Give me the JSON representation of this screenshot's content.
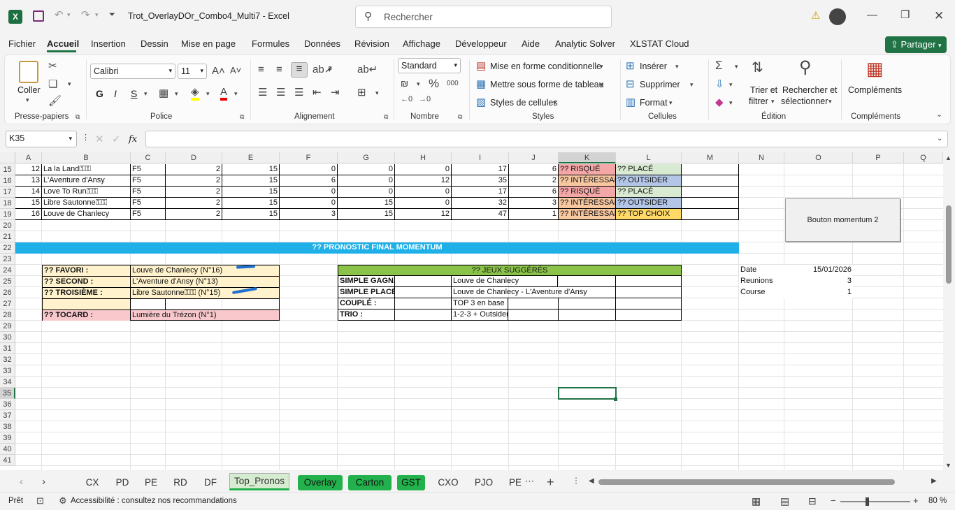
{
  "window": {
    "title": "Trot_OverlayDOr_Combo4_Multi7  -  Excel",
    "search_placeholder": "Rechercher"
  },
  "menu": {
    "items": [
      "Fichier",
      "Accueil",
      "Insertion",
      "Dessin",
      "Mise en page",
      "Formules",
      "Données",
      "Révision",
      "Affichage",
      "Développeur",
      "Aide",
      "Analytic Solver",
      "XLSTAT Cloud"
    ],
    "share": "Partager"
  },
  "ribbon": {
    "clipboard": {
      "paste": "Coller",
      "group": "Presse-papiers"
    },
    "font": {
      "name": "Calibri",
      "size": "11",
      "bold": "G",
      "italic": "I",
      "underline": "S",
      "group": "Police"
    },
    "alignment": {
      "group": "Alignement"
    },
    "number": {
      "format": "Standard",
      "group": "Nombre"
    },
    "styles": {
      "conditional": "Mise en forme conditionnelle",
      "table": "Mettre sous forme de tableau",
      "cell_styles": "Styles de cellules",
      "group": "Styles"
    },
    "cells": {
      "insert": "Insérer",
      "delete": "Supprimer",
      "format": "Format",
      "group": "Cellules"
    },
    "editing": {
      "sort1": "Trier et",
      "sort2": "filtrer",
      "find1": "Rechercher et",
      "find2": "sélectionner",
      "group": "Édition"
    },
    "addins": {
      "label": "Compléments",
      "group": "Compléments"
    }
  },
  "formula": {
    "namebox": "K35",
    "fx": "fx"
  },
  "columns": [
    "A",
    "B",
    "C",
    "D",
    "E",
    "F",
    "G",
    "H",
    "I",
    "J",
    "K",
    "L",
    "M",
    "N",
    "O",
    "P",
    "Q"
  ],
  "rows": [
    "15",
    "16",
    "17",
    "18",
    "19",
    "20",
    "21",
    "22",
    "23",
    "24",
    "25",
    "26",
    "27",
    "28",
    "29",
    "30",
    "31",
    "32",
    "33",
    "34",
    "35",
    "36",
    "37",
    "38",
    "39",
    "40",
    "41"
  ],
  "data_rows": [
    {
      "a": "12",
      "b": "La la Land⚿⚿",
      "c": "F5",
      "d": "2",
      "e": "15",
      "f": "0",
      "g": "0",
      "h": "0",
      "i": "17",
      "j": "6",
      "k": "?? RISQUÉ",
      "l": "?? PLACÉ"
    },
    {
      "a": "13",
      "b": "L'Aventure d'Ansy",
      "c": "F5",
      "d": "2",
      "e": "15",
      "f": "6",
      "g": "0",
      "h": "12",
      "i": "35",
      "j": "2",
      "k": "?? INTÉRESSAN",
      "l": "?? OUTSIDER"
    },
    {
      "a": "14",
      "b": "Love To Run⚿⚿",
      "c": "F5",
      "d": "2",
      "e": "15",
      "f": "0",
      "g": "0",
      "h": "0",
      "i": "17",
      "j": "6",
      "k": "?? RISQUÉ",
      "l": "?? PLACÉ"
    },
    {
      "a": "15",
      "b": "Libre Sautonne⚿⚿",
      "c": "F5",
      "d": "2",
      "e": "15",
      "f": "0",
      "g": "15",
      "h": "0",
      "i": "32",
      "j": "3",
      "k": "?? INTÉRESSAN",
      "l": "?? OUTSIDER"
    },
    {
      "a": "16",
      "b": "Louve de Chanlecy",
      "c": "F5",
      "d": "2",
      "e": "15",
      "f": "3",
      "g": "15",
      "h": "12",
      "i": "47",
      "j": "1",
      "k": "?? INTÉRESSAN",
      "l": "?? TOP CHOIX"
    }
  ],
  "banner": "?? PRONOSTIC FINAL MOMENTUM",
  "button": "Bouton momentum 2",
  "pronos": [
    {
      "label": "?? FAVORI :",
      "value": "Louve de Chanlecy (N°16)"
    },
    {
      "label": "?? SECOND :",
      "value": "L'Aventure d'Ansy (N°13)"
    },
    {
      "label": "?? TROISIÈME :",
      "value": "Libre Sautonne⚿⚿ (N°15)"
    },
    {
      "label": "?? TOCARD :",
      "value": "Lumière du Trézon (N°1)"
    }
  ],
  "jeux": {
    "title": "?? JEUX SUGGÉRÉS",
    "rows": [
      {
        "label": "SIMPLE GAGNANT :",
        "value": "Louve de Chanlecy"
      },
      {
        "label": "SIMPLE PLACÉ :",
        "value": "Louve de Chanlecy - L'Aventure d'Ansy"
      },
      {
        "label": "COUPLÉ :",
        "value": "TOP 3 en base"
      },
      {
        "label": "TRIO :",
        "value": "1-2-3 + Outsider"
      }
    ]
  },
  "info": [
    {
      "label": "Date",
      "value": "15/01/2026"
    },
    {
      "label": "Reunions",
      "value": "3"
    },
    {
      "label": "Course",
      "value": "1"
    }
  ],
  "sheets": [
    "CX",
    "PD",
    "PE",
    "RD",
    "DF",
    "Top_Pronos",
    "Overlay",
    "Carton",
    "GST",
    "CXO",
    "PJO",
    "PE"
  ],
  "status": {
    "ready": "Prêt",
    "accessibility": "Accessibilité : consultez nos recommandations",
    "zoom": "80 %"
  },
  "colors": {
    "excel_green": "#217346",
    "risk": "#f4a7a7",
    "interest": "#f7c7a0",
    "place": "#d9ead3",
    "outsider": "#b4c6e7",
    "topchoix": "#ffd966",
    "banner": "#1fb0e8",
    "jeux": "#8bc34a",
    "pronos": "#fff2cc",
    "tocard": "#f8c8cc"
  }
}
